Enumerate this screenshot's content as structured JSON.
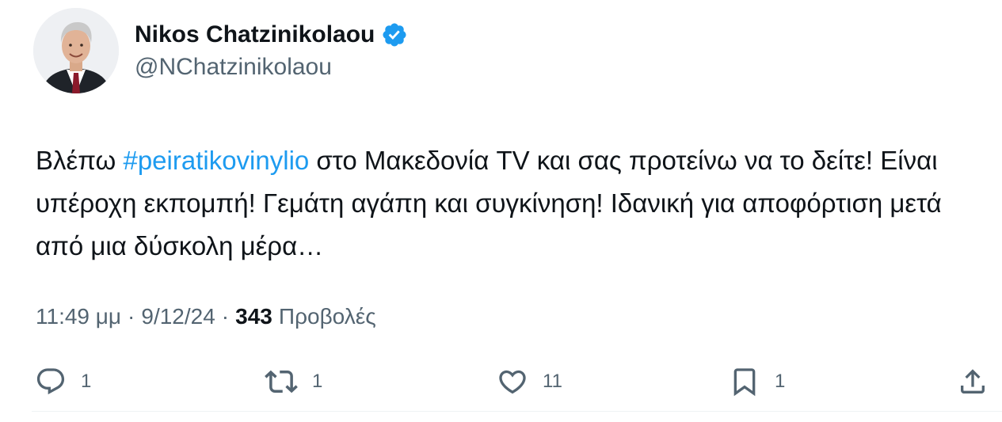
{
  "colors": {
    "accent": "#1d9bf0",
    "text_primary": "#0f1419",
    "text_secondary": "#536471",
    "verified_badge": "#1d9bf0"
  },
  "author": {
    "display_name": "Nikos Chatzinikolaou",
    "handle": "@NChatzinikolaou",
    "verified": true,
    "avatar_icon": "avatar-portrait"
  },
  "tweet": {
    "text_before": "Βλέπω ",
    "hashtag": "#peiratikovinylio",
    "text_after": " στο Μακεδονία TV και σας προτείνω να το δείτε! Είναι υπέροχη εκπομπή! Γεμάτη αγάπη και συγκίνηση! Ιδανική για αποφόρτιση μετά από μια δύσκολη μέρα…"
  },
  "meta": {
    "time": "11:49 μμ",
    "separator": "·",
    "date": "9/12/24",
    "views_count": "343",
    "views_label": "Προβολές"
  },
  "actions": {
    "replies": {
      "icon": "reply-icon",
      "count": "1"
    },
    "reposts": {
      "icon": "repost-icon",
      "count": "1"
    },
    "likes": {
      "icon": "heart-icon",
      "count": "11"
    },
    "bookmarks": {
      "icon": "bookmark-icon",
      "count": "1"
    },
    "share": {
      "icon": "share-icon"
    }
  }
}
